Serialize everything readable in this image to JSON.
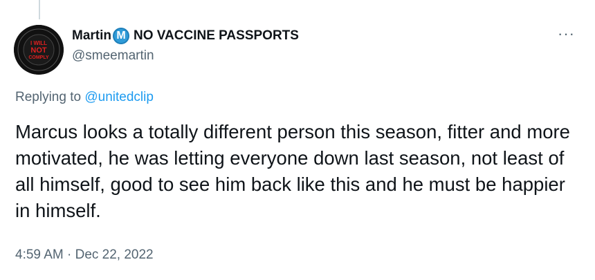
{
  "tweet": {
    "display_name": "Martin",
    "badge_letter": "M",
    "name_suffix": "NO VACCINE PASSPORTS",
    "handle": "@smeemartin",
    "more_glyph": "···",
    "avatar": {
      "icon": "i-will-not-comply-badge",
      "lines": [
        "I WILL",
        "NOT",
        "COMPLY"
      ],
      "colors": {
        "background": "#111111",
        "text": "#e02020"
      }
    },
    "replying_prefix": "Replying to",
    "replying_to": "@unitedclip",
    "text": "Marcus looks a totally different person this season, fitter and more motivated, he was letting everyone down last season, not least of all himself, good to see him back like this and he must be happier in himself.",
    "timestamp": "4:59 AM · Dec 22, 2022"
  },
  "colors": {
    "text": "#0f1419",
    "secondary": "#536471",
    "link": "#1d9bf0",
    "badge": "#2f9bd8"
  }
}
